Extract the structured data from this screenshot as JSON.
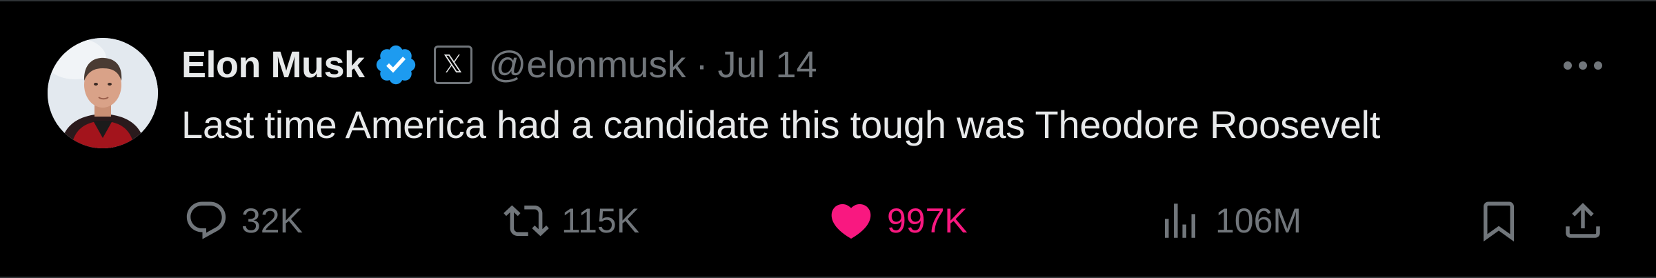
{
  "tweet": {
    "author": {
      "display_name": "Elon Musk",
      "handle": "@elonmusk",
      "verified_icon": "verified-badge-icon",
      "affiliate_icon": "x-logo-icon",
      "affiliate_glyph": "𝕏"
    },
    "separator": "·",
    "timestamp": "Jul 14",
    "text": "Last time America had a candidate this tough was Theodore Roosevelt",
    "more_icon": "more-horizontal-icon"
  },
  "actions": {
    "replies": {
      "icon": "reply-icon",
      "count": "32K"
    },
    "reposts": {
      "icon": "repost-icon",
      "count": "115K"
    },
    "likes": {
      "icon": "heart-filled-icon",
      "count": "997K",
      "liked": true
    },
    "views": {
      "icon": "analytics-icon",
      "count": "106M"
    },
    "bookmark": {
      "icon": "bookmark-icon"
    },
    "share": {
      "icon": "share-icon"
    }
  },
  "colors": {
    "background": "#000000",
    "primary_text": "#e7e9ea",
    "secondary_text": "#71767b",
    "verified_blue": "#1d9bf0",
    "like_pink": "#f91880"
  }
}
